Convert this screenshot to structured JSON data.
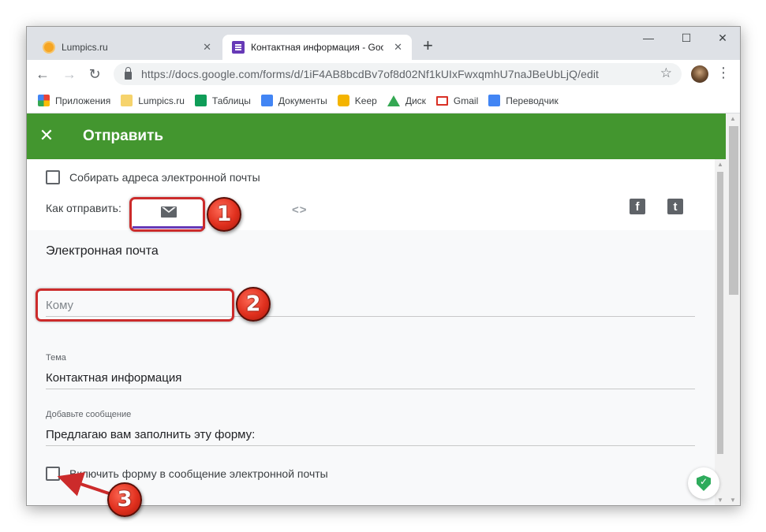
{
  "browser": {
    "tabs": [
      {
        "title": "Lumpics.ru",
        "icon": "lumpics-favicon",
        "active": false
      },
      {
        "title": "Контактная информация - Google Формы",
        "icon": "google-forms-favicon",
        "active": true
      }
    ],
    "tab_close_symbol": "✕",
    "new_tab_symbol": "+",
    "window_controls": {
      "minimize": "—",
      "maximize": "☐",
      "close": "✕"
    },
    "nav": {
      "back": "←",
      "forward": "→",
      "reload": "↻"
    },
    "url": "https://docs.google.com/forms/d/1iF4AB8bcdBv7of8d02Nf1kUIxFwxqmhU7naJBeUbLjQ/edit",
    "star_symbol": "☆",
    "menu_symbol": "⋮",
    "bookmarks": [
      {
        "label": "Приложения",
        "icon": "apps-icon"
      },
      {
        "label": "Lumpics.ru",
        "icon": "folder-icon"
      },
      {
        "label": "Таблицы",
        "icon": "sheets-icon"
      },
      {
        "label": "Документы",
        "icon": "docs-icon"
      },
      {
        "label": "Keep",
        "icon": "keep-icon"
      },
      {
        "label": "Диск",
        "icon": "drive-icon"
      },
      {
        "label": "Gmail",
        "icon": "gmail-icon"
      },
      {
        "label": "Переводчик",
        "icon": "translate-icon"
      }
    ]
  },
  "dialog": {
    "close_symbol": "✕",
    "title": "Отправить",
    "collect_emails_label": "Собирать адреса электронной почты",
    "send_via_label": "Как отправить:",
    "link_symbol": "<>",
    "facebook_symbol": "f",
    "twitter_symbol": "t",
    "email_section_title": "Электронная почта",
    "to_placeholder": "Кому",
    "subject_label": "Тема",
    "subject_value": "Контактная информация",
    "message_label": "Добавьте сообщение",
    "message_value": "Предлагаю вам заполнить эту форму:",
    "include_form_label": "Включить форму в сообщение электронной почты",
    "active_method_color": "#673ab7"
  },
  "annotations": {
    "badges": [
      "1",
      "2",
      "3"
    ],
    "color": "#cc2b2b"
  },
  "colors": {
    "header": "#43962f",
    "forms_purple": "#673ab7"
  }
}
